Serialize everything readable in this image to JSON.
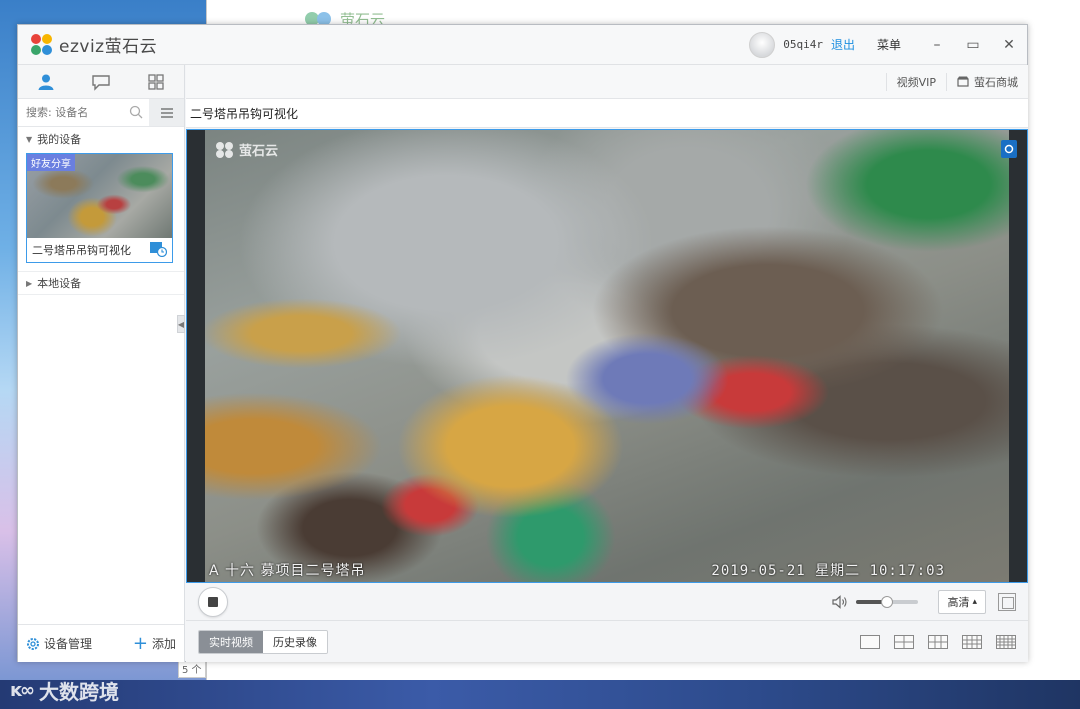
{
  "background": {
    "bg_window_logo_text": "萤石云",
    "watermark_text": "大数跨境",
    "watermark_logo": "ᴋ∞",
    "side_strip_text": "5 个"
  },
  "app": {
    "brand_name": "ezviz萤石云",
    "username": "05qi4r",
    "logout": "退出",
    "menu": "菜单",
    "minimize": "–",
    "maximize": "▭",
    "close": "✕"
  },
  "left": {
    "search_placeholder": "搜索: 设备名",
    "group_my_devices": "我的设备",
    "share_badge": "好友分享",
    "device_name": "二号塔吊吊钩可视化",
    "group_local_devices": "本地设备",
    "device_mgmt": "设备管理",
    "add": "添加",
    "add_icon": "+"
  },
  "right": {
    "toolbar_vip": "视频VIP",
    "toolbar_store": "萤石商城",
    "video_title": "二号塔吊吊钩可视化",
    "video_logo": "萤石云",
    "osd_left": "A 十六 募项目二号塔吊",
    "osd_right": "2019-05-21 星期二 10:17:03",
    "quality": "高清",
    "quality_arrow": "▴",
    "volume_level": 0.5,
    "tab_live": "实时视频",
    "tab_history": "历史录像"
  },
  "colors": {
    "accent": "#3d9be9",
    "link": "#1e8fe0",
    "share_badge": "#6a7fe0"
  }
}
